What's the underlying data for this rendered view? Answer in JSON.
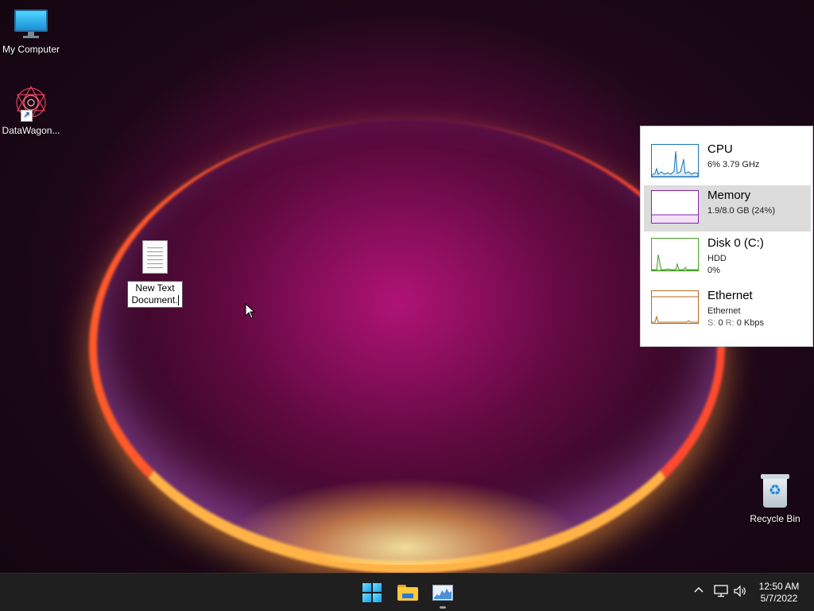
{
  "desktop": {
    "icons": [
      {
        "label": "My Computer",
        "icon": "computer-icon"
      },
      {
        "label": "DataWagon...",
        "icon": "datawagon-app-icon"
      },
      {
        "label": "Recycle Bin",
        "icon": "recycle-bin-icon"
      }
    ],
    "rename": {
      "line1": "New Text",
      "line2": "Document.",
      "icon": "text-document-icon"
    }
  },
  "performance": {
    "cpu": {
      "title": "CPU",
      "detail": "6% 3.79 GHz",
      "color": "#1a76b5"
    },
    "memory": {
      "title": "Memory",
      "detail": "1.9/8.0 GB (24%)",
      "color": "#8b22b0"
    },
    "disk": {
      "title": "Disk 0 (C:)",
      "type": "HDD",
      "usage": "0%",
      "color": "#4aa02c"
    },
    "ethernet": {
      "title": "Ethernet",
      "adapter": "Ethernet",
      "send_label": "S:",
      "send_value": "0",
      "recv_label": "R:",
      "recv_value": "0 Kbps",
      "color": "#b86a1a"
    }
  },
  "taskbar": {
    "apps": [
      {
        "name": "Start",
        "icon": "windows-start-icon"
      },
      {
        "name": "File Explorer",
        "icon": "file-explorer-icon"
      },
      {
        "name": "Task Manager",
        "icon": "task-manager-icon"
      }
    ],
    "tray": {
      "chevron": "^",
      "network_icon": "network-icon",
      "volume_icon": "volume-icon"
    },
    "clock": {
      "time": "12:50 AM",
      "date": "5/7/2022"
    }
  }
}
